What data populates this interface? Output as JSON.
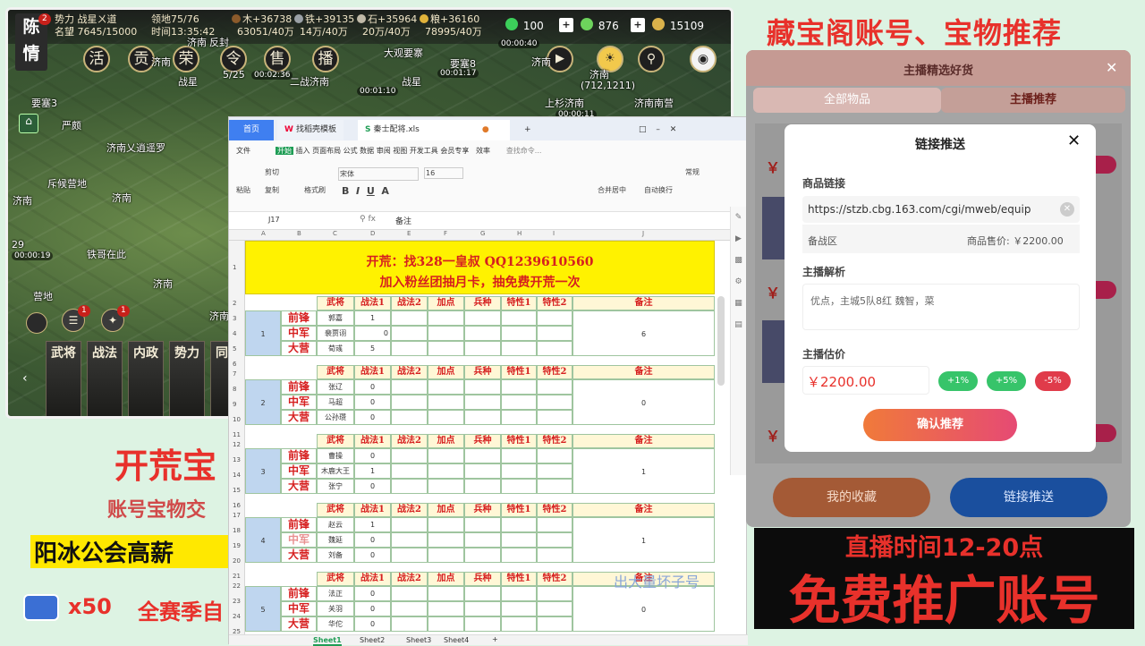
{
  "game": {
    "player_name": "陈情",
    "player_badge": "2",
    "force": "势力 战星ㄨ道",
    "prestige": "名望 7645/15000",
    "land": "领地75/76",
    "time": "时间13:35:42",
    "wood": "木+36738",
    "wood_cap": "63051/40万",
    "iron": "铁+39135",
    "iron_cap": "14万/40万",
    "stone": "石+35964",
    "stone_cap": "20万/40万",
    "grain": "粮+36160",
    "grain_cap": "78995/40万",
    "jade": "100",
    "copper": "876",
    "gold": "15109",
    "menu": [
      "活",
      "贡",
      "荣",
      "令",
      "售",
      "播"
    ],
    "map_labels": [
      "济南",
      "反封",
      "大观要寨",
      "济南",
      "战星",
      "二战济南",
      "战星",
      "要塞8",
      "济南",
      "要塞3",
      "严颇",
      "济南乂逍遥罗",
      "斥候营地",
      "济南",
      "铁哥在此",
      "济南",
      "营地",
      "济南",
      "济南",
      "上杉济南",
      "济南南营"
    ],
    "timers": [
      "00:00:40",
      "00:02:36",
      "00:01:17",
      "00:01:10",
      "00:00:11",
      "00:00:19"
    ],
    "city_name": "济南",
    "city_coords": "(712,1211)",
    "counts": [
      "5/25",
      "29"
    ],
    "side_tabs": [
      "武将",
      "战法",
      "内政",
      "势力",
      "同盟"
    ]
  },
  "overlay": {
    "kaihuang": "开荒宝",
    "account": "账号宝物交",
    "guild": "阳冰公会高薪",
    "multiplier": "x50",
    "season": "全赛季自"
  },
  "sheet": {
    "tabs": [
      "首页",
      "找稻壳模板",
      "秦士配将.xls"
    ],
    "menu": [
      "文件",
      "开始",
      "插入",
      "页面布局",
      "公式",
      "数据",
      "审阅",
      "视图",
      "开发工具",
      "会员专享",
      "效率",
      "查找命令..."
    ],
    "ribbon_btns": [
      "剪切",
      "复制",
      "格式刷",
      "粘贴",
      "宋体",
      "16",
      "合并居中",
      "自动换行",
      "常规"
    ],
    "cell_ref": "J17",
    "formula": "备注",
    "col_letters": [
      "A",
      "B",
      "C",
      "D",
      "E",
      "F",
      "G",
      "H",
      "I",
      "J"
    ],
    "banner1": "开荒：找328一皇叔  QQ1239610560",
    "banner2": "加入粉丝团抽月卡，抽免费开荒一次",
    "headers": [
      "武将",
      "战法1",
      "战法2",
      "加点",
      "兵种",
      "特性1",
      "特性2",
      "备注"
    ],
    "positions": [
      "前锋",
      "中军",
      "大营"
    ],
    "groups": [
      {
        "no": "1",
        "rows": [
          [
            "郭嘉",
            "1",
            ""
          ],
          [
            "裴贾诩",
            "",
            "0"
          ],
          [
            "荀彧",
            "5",
            ""
          ]
        ],
        "note": "6"
      },
      {
        "no": "2",
        "rows": [
          [
            "张辽",
            "0",
            ""
          ],
          [
            "马超",
            "0",
            ""
          ],
          [
            "公孙瓒",
            "0",
            ""
          ]
        ],
        "note": "0"
      },
      {
        "no": "3",
        "rows": [
          [
            "曹操",
            "0",
            ""
          ],
          [
            "木鹿大王",
            "1",
            ""
          ],
          [
            "张宁",
            "0",
            ""
          ]
        ],
        "note": "1"
      },
      {
        "no": "4",
        "rows": [
          [
            "赵云",
            "1",
            ""
          ],
          [
            "魏延",
            "0",
            ""
          ],
          [
            "刘备",
            "0",
            ""
          ]
        ],
        "note": "1"
      },
      {
        "no": "5",
        "rows": [
          [
            "法正",
            "0",
            ""
          ],
          [
            "关羽",
            "0",
            ""
          ],
          [
            "华佗",
            "0",
            ""
          ]
        ],
        "note": "0"
      }
    ],
    "row_numbers": [
      "1",
      "2",
      "3",
      "4",
      "5",
      "6",
      "7",
      "8",
      "9",
      "10",
      "11",
      "12",
      "13",
      "14",
      "15",
      "16",
      "17",
      "18",
      "19",
      "20",
      "21",
      "22",
      "23",
      "24",
      "25"
    ],
    "sheet_tabs": [
      "Sheet1",
      "Sheet2",
      "Sheet3",
      "Sheet4"
    ],
    "watermark": "出大量坏子号"
  },
  "right": {
    "title": "藏宝阁账号、宝物推荐",
    "panel_title": "主播精选好货",
    "panel_tabs": [
      "全部物品",
      "主播推荐"
    ],
    "btn_fav": "我的收藏",
    "btn_push": "链接推送",
    "modal": {
      "title": "链接推送",
      "link_label": "商品链接",
      "link_value": "https://stzb.cbg.163.com/cgi/mweb/equip",
      "zone": "备战区",
      "price_label": "商品售价: ￥2200.00",
      "analysis_label": "主播解析",
      "analysis_text": "优点，主城5队8红 魏智，菜",
      "estimate_label": "主播估价",
      "estimate_value": "￥2200.00",
      "adj_plus1": "+1%",
      "adj_plus5": "+5%",
      "adj_minus5": "-5%",
      "confirm": "确认推荐"
    },
    "live_time": "直播时间12-20点",
    "promo": "免费推广账号"
  },
  "colors": {
    "accent_red": "#e8312b",
    "sheet_yellow": "#fff200",
    "push_blue": "#1e6fd9",
    "fav_orange": "#d46a2a",
    "modal_green": "#37c46a"
  }
}
